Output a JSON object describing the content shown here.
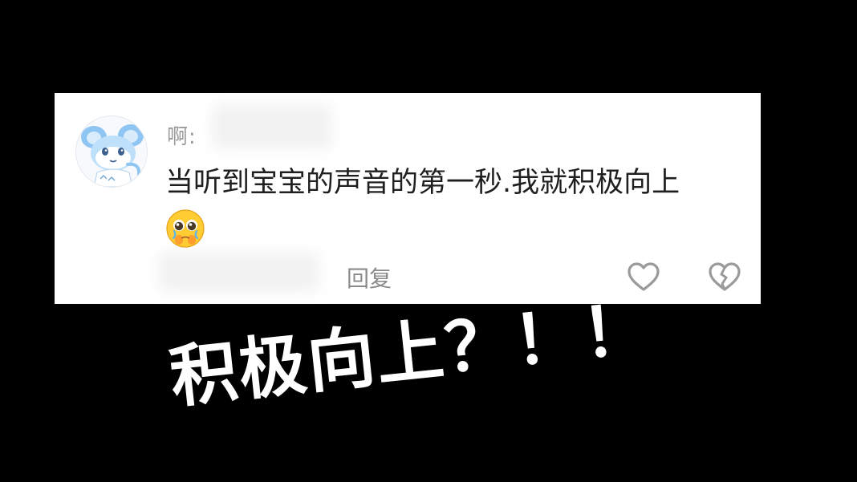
{
  "comment": {
    "username": "啊:",
    "text": "当听到宝宝的声音的第一秒.我就积极向上",
    "emoji": "pleading-face-emoji",
    "reply_label": "回复",
    "like_icon": "heart-outline-icon",
    "dislike_icon": "broken-heart-outline-icon"
  },
  "overlay_caption": "积极向上？！！",
  "colors": {
    "background": "#000000",
    "card": "#ffffff",
    "text": "#1f1f1f",
    "muted": "#8a8a8a",
    "icon": "#9a9a9a",
    "caption": "#ffffff"
  }
}
